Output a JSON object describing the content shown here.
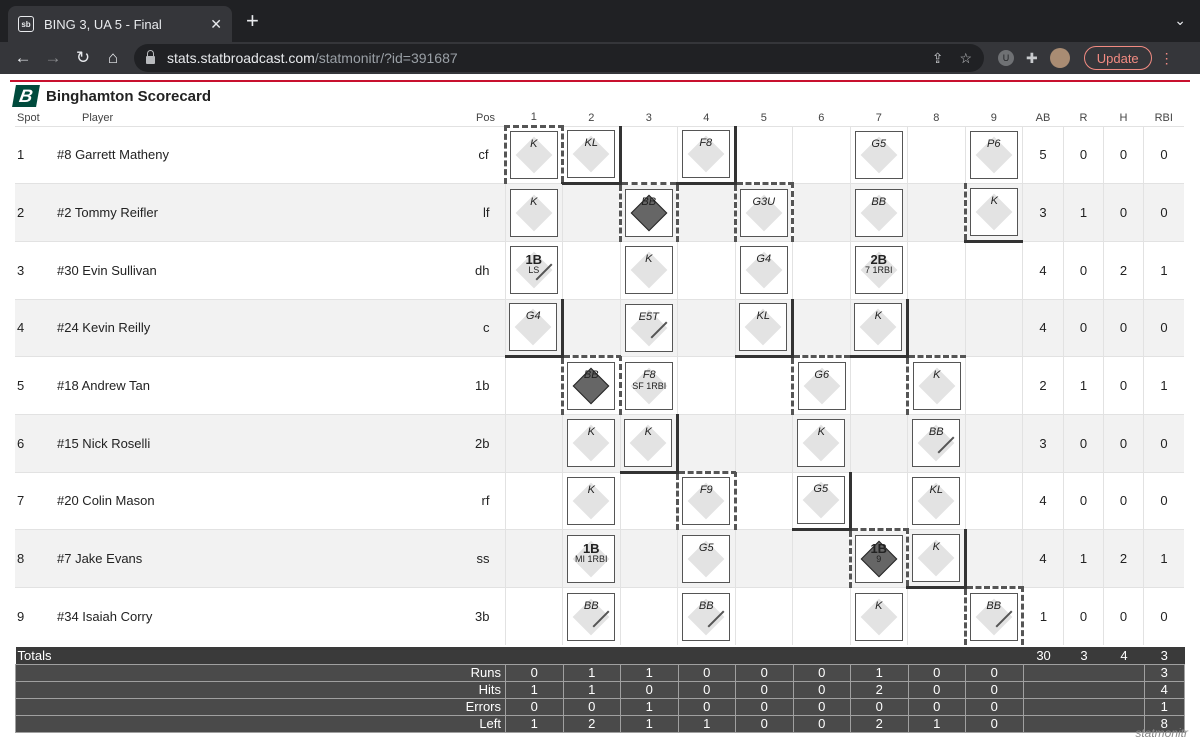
{
  "browser": {
    "tab_title": "BING 3, UA 5 - Final",
    "favicon": "sb",
    "url_host": "stats.statbroadcast.com",
    "url_path": "/statmonitr/?id=391687",
    "update_label": "Update"
  },
  "scorecard": {
    "title": "Binghamton Scorecard",
    "headers": {
      "spot": "Spot",
      "player": "Player",
      "pos": "Pos",
      "innings": [
        "1",
        "2",
        "3",
        "4",
        "5",
        "6",
        "7",
        "8",
        "9"
      ],
      "ab": "AB",
      "r": "R",
      "h": "H",
      "rbi": "RBI"
    },
    "rows": [
      {
        "spot": "1",
        "player": "#8 Garrett Matheny",
        "pos": "cf",
        "ab": "5",
        "r": "0",
        "h": "0",
        "rbi": "0",
        "cells": [
          {
            "r": "K"
          },
          {
            "r": "KL"
          },
          null,
          {
            "r": "F8"
          },
          null,
          null,
          {
            "r": "G5"
          },
          null,
          {
            "r": "P6"
          }
        ]
      },
      {
        "spot": "2",
        "player": "#2 Tommy Reifler",
        "pos": "lf",
        "ab": "3",
        "r": "1",
        "h": "0",
        "rbi": "0",
        "cells": [
          {
            "r": "K"
          },
          null,
          {
            "r": "BB",
            "scored": true
          },
          null,
          {
            "r": "G3U"
          },
          null,
          {
            "r": "BB"
          },
          null,
          {
            "r": "K"
          }
        ]
      },
      {
        "spot": "3",
        "player": "#30 Evin Sullivan",
        "pos": "dh",
        "ab": "4",
        "r": "0",
        "h": "2",
        "rbi": "1",
        "cells": [
          {
            "r": "1B",
            "big": true,
            "sub": "LS",
            "slash": true
          },
          null,
          {
            "r": "K"
          },
          null,
          {
            "r": "G4"
          },
          null,
          {
            "r": "2B",
            "big": true,
            "sub": "7 1RBI"
          },
          null,
          null
        ]
      },
      {
        "spot": "4",
        "player": "#24 Kevin Reilly",
        "pos": "c",
        "ab": "4",
        "r": "0",
        "h": "0",
        "rbi": "0",
        "cells": [
          {
            "r": "G4"
          },
          null,
          {
            "r": "E5T",
            "slash": true
          },
          null,
          {
            "r": "KL"
          },
          null,
          {
            "r": "K"
          },
          null,
          null
        ]
      },
      {
        "spot": "5",
        "player": "#18 Andrew Tan",
        "pos": "1b",
        "ab": "2",
        "r": "1",
        "h": "0",
        "rbi": "1",
        "cells": [
          null,
          {
            "r": "BB",
            "scored": true
          },
          {
            "r": "F8",
            "sub": "SF 1RBI"
          },
          null,
          null,
          {
            "r": "G6"
          },
          null,
          {
            "r": "K"
          },
          null
        ]
      },
      {
        "spot": "6",
        "player": "#15 Nick Roselli",
        "pos": "2b",
        "ab": "3",
        "r": "0",
        "h": "0",
        "rbi": "0",
        "cells": [
          null,
          {
            "r": "K"
          },
          {
            "r": "K"
          },
          null,
          null,
          {
            "r": "K"
          },
          null,
          {
            "r": "BB",
            "slash": true
          },
          null
        ]
      },
      {
        "spot": "7",
        "player": "#20 Colin Mason",
        "pos": "rf",
        "ab": "4",
        "r": "0",
        "h": "0",
        "rbi": "0",
        "cells": [
          null,
          {
            "r": "K"
          },
          null,
          {
            "r": "F9"
          },
          null,
          {
            "r": "G5"
          },
          null,
          {
            "r": "KL"
          },
          null
        ]
      },
      {
        "spot": "8",
        "player": "#7 Jake Evans",
        "pos": "ss",
        "ab": "4",
        "r": "1",
        "h": "2",
        "rbi": "1",
        "cells": [
          null,
          {
            "r": "1B",
            "big": true,
            "sub": "MI 1RBI"
          },
          null,
          {
            "r": "G5"
          },
          null,
          null,
          {
            "r": "1B",
            "big": true,
            "scored": true,
            "sub": "9"
          },
          {
            "r": "K"
          },
          null
        ]
      },
      {
        "spot": "9",
        "player": "#34 Isaiah Corry",
        "pos": "3b",
        "ab": "1",
        "r": "0",
        "h": "0",
        "rbi": "0",
        "cells": [
          null,
          {
            "r": "BB",
            "slash": true
          },
          null,
          {
            "r": "BB",
            "slash": true
          },
          null,
          null,
          {
            "r": "K"
          },
          null,
          {
            "r": "BB",
            "slash": true
          }
        ]
      }
    ],
    "totals": {
      "label": "Totals",
      "ab": "30",
      "r": "3",
      "h": "4",
      "rbi": "3",
      "lines": [
        {
          "label": "Runs",
          "values": [
            "0",
            "1",
            "1",
            "0",
            "0",
            "0",
            "1",
            "0",
            "0"
          ],
          "total": "3"
        },
        {
          "label": "Hits",
          "values": [
            "1",
            "1",
            "0",
            "0",
            "0",
            "0",
            "2",
            "0",
            "0"
          ],
          "total": "4"
        },
        {
          "label": "Errors",
          "values": [
            "0",
            "0",
            "1",
            "0",
            "0",
            "0",
            "0",
            "0",
            "0"
          ],
          "total": "1"
        },
        {
          "label": "Left",
          "values": [
            "1",
            "2",
            "1",
            "1",
            "0",
            "0",
            "2",
            "1",
            "0"
          ],
          "total": "8"
        }
      ]
    },
    "watermark": "statmonitr"
  },
  "colors": {
    "accent": "#c8102e",
    "chrome": "#35363a",
    "update": "#f28b82"
  }
}
